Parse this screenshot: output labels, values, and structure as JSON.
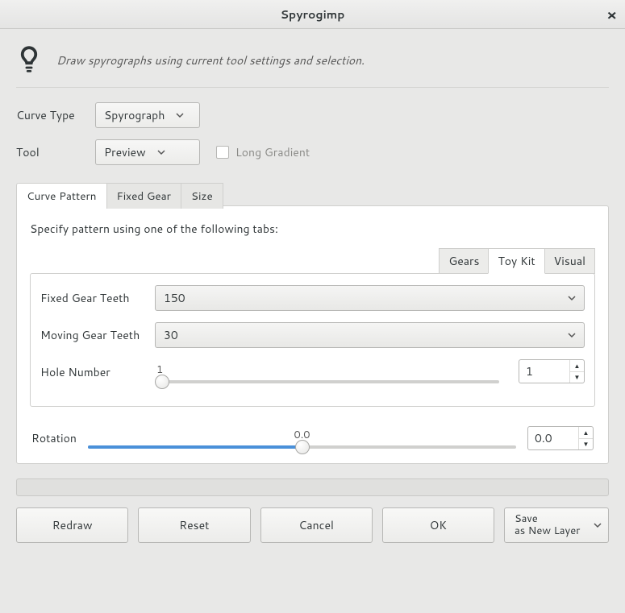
{
  "window": {
    "title": "Spyrogimp"
  },
  "header": {
    "subtitle": "Draw spyrographs using current tool settings and selection."
  },
  "form": {
    "curve_type_label": "Curve Type",
    "curve_type_value": "Spyrograph",
    "tool_label": "Tool",
    "tool_value": "Preview",
    "long_gradient_label": "Long Gradient"
  },
  "tabs": {
    "curve_pattern": "Curve Pattern",
    "fixed_gear": "Fixed Gear",
    "size": "Size"
  },
  "pattern": {
    "instruction": "Specify pattern using one of the following tabs:",
    "subtabs": {
      "gears": "Gears",
      "toykit": "Toy Kit",
      "visual": "Visual"
    },
    "fixed_gear_teeth_label": "Fixed Gear Teeth",
    "fixed_gear_teeth_value": "150",
    "moving_gear_teeth_label": "Moving Gear Teeth",
    "moving_gear_teeth_value": "30",
    "hole_number_label": "Hole Number",
    "hole_tick": "1",
    "hole_value": "1"
  },
  "rotation": {
    "label": "Rotation",
    "tick": "0.0",
    "value": "0.0"
  },
  "buttons": {
    "redraw": "Redraw",
    "reset": "Reset",
    "cancel": "Cancel",
    "ok": "OK",
    "save_line1": "Save",
    "save_line2": "as New Layer"
  }
}
